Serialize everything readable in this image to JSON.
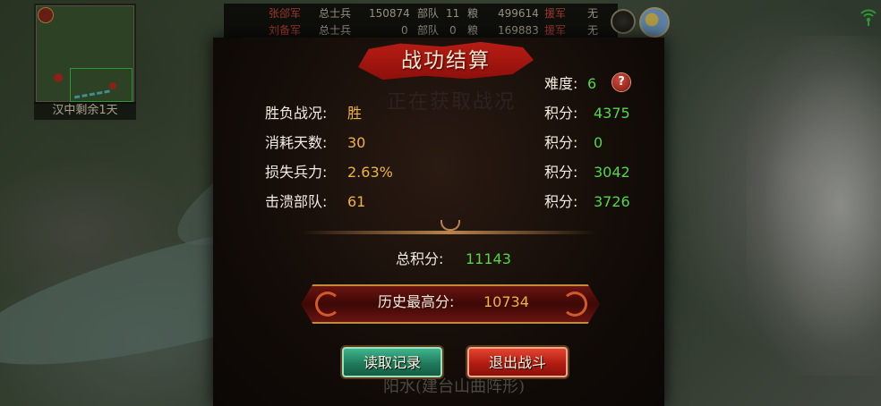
{
  "hud": {
    "minimap_caption": "汉中剩余1天",
    "row1": {
      "army": "张郃军",
      "troops_label": "总士兵",
      "troops_value": "150874",
      "units_label": "部队",
      "units_value": "11",
      "food_label": "粮",
      "food_value": "499614",
      "reinforce_label": "援军",
      "reinforce_value": "无"
    },
    "row2": {
      "army": "刘备军",
      "troops_label": "总士兵",
      "troops_value": "0",
      "units_label": "部队",
      "units_value": "0",
      "food_label": "粮",
      "food_value": "169883",
      "reinforce_label": "援军",
      "reinforce_value": "无"
    }
  },
  "dialog": {
    "title": "战功结算",
    "background_text": "正在获取战况",
    "bottom_background_text": "阳水(建台山曲阵形)",
    "difficulty_label": "难度:",
    "difficulty_value": "6",
    "help_glyph": "?",
    "rows": [
      {
        "label": "胜负战况:",
        "value": "胜",
        "score_label": "积分:",
        "score": "4375"
      },
      {
        "label": "消耗天数:",
        "value": "30",
        "score_label": "积分:",
        "score": "0"
      },
      {
        "label": "损失兵力:",
        "value": "2.63%",
        "score_label": "积分:",
        "score": "3042"
      },
      {
        "label": "击溃部队:",
        "value": "61",
        "score_label": "积分:",
        "score": "3726"
      }
    ],
    "total_label": "总积分:",
    "total_value": "11143",
    "best_label": "历史最高分:",
    "best_value": "10734",
    "load_button": "读取记录",
    "exit_button": "退出战斗"
  },
  "colors": {
    "label_text": "#f1ecdf",
    "value_yellow": "#f0b341",
    "value_green": "#52d846",
    "army_red": "#d84b3a",
    "button_green": "#1f7a5b",
    "button_red": "#b21c12"
  },
  "icons": [
    "minimap-badge-icon",
    "settings-ring-icon",
    "weather-sun-icon",
    "signal-icon",
    "help-icon"
  ]
}
